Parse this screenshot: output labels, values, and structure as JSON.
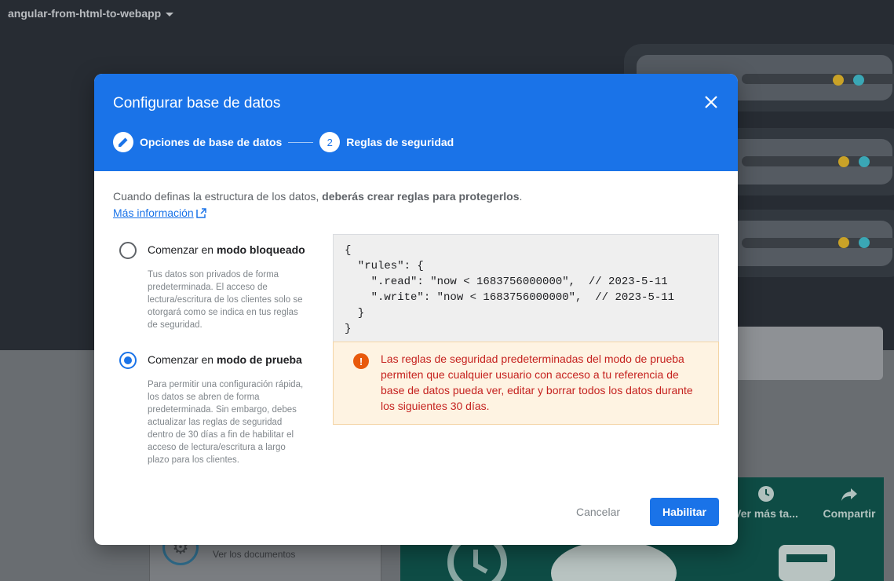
{
  "project": {
    "name": "angular-from-html-to-webapp"
  },
  "background": {
    "actions": [
      {
        "label": "Ver más ta...",
        "icon": "clock-icon"
      },
      {
        "label": "Compartir",
        "icon": "share-icon"
      }
    ],
    "docs_label": "Ver los documentos"
  },
  "modal": {
    "title": "Configurar base de datos",
    "steps": [
      {
        "number": "",
        "label": "Opciones de base de datos",
        "icon": "pencil-icon"
      },
      {
        "number": "2",
        "label": "Reglas de seguridad"
      }
    ],
    "intro_prefix": "Cuando definas la estructura de los datos, ",
    "intro_bold": "deberás crear reglas para protegerlos",
    "intro_suffix": ".",
    "more_link": "Más información",
    "options": [
      {
        "title_prefix": "Comenzar en ",
        "title_bold": "modo bloqueado",
        "description": "Tus datos son privados de forma predeterminada. El acceso de lectura/escritura de los clientes solo se otorgará como se indica en tus reglas de seguridad.",
        "selected": false
      },
      {
        "title_prefix": "Comenzar en ",
        "title_bold": "modo de prueba",
        "description": "Para permitir una configuración rápida, los datos se abren de forma predeterminada. Sin embargo, debes actualizar las reglas de seguridad dentro de 30 días a fin de habilitar el acceso de lectura/escritura a largo plazo para los clientes.",
        "selected": true
      }
    ],
    "code": "{\n  \"rules\": {\n    \".read\": \"now < 1683756000000\",  // 2023-5-11\n    \".write\": \"now < 1683756000000\",  // 2023-5-11\n  }\n}",
    "warning": "Las reglas de seguridad predeterminadas del modo de prueba permiten que cualquier usuario con acceso a tu referencia de base de datos pueda ver, editar y borrar todos los datos durante los siguientes 30 días.",
    "cancel_label": "Cancelar",
    "enable_label": "Habilitar"
  }
}
